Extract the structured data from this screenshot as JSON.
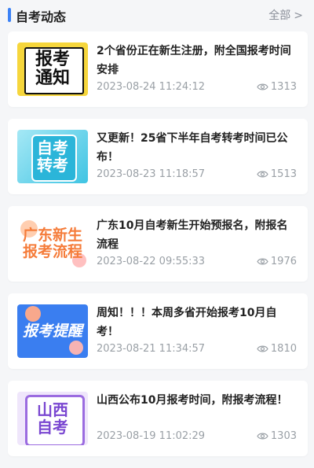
{
  "header": {
    "title": "自考动态",
    "more_label": "全部"
  },
  "news": [
    {
      "thumb": [
        "报考",
        "通知"
      ],
      "title": "2个省份正在新生注册，附全国报考时间安排",
      "date": "2023-08-24 11:24:12",
      "views": "1313"
    },
    {
      "thumb": [
        "自考",
        "转考"
      ],
      "title": "又更新！25省下半年自考转考时间已公布！",
      "date": "2023-08-23 11:18:57",
      "views": "1513"
    },
    {
      "thumb": [
        "广东新生",
        "报考流程"
      ],
      "title": "广东10月自考新生开始预报名，附报名流程",
      "date": "2023-08-22 09:55:33",
      "views": "1976"
    },
    {
      "thumb": [
        "报考提醒"
      ],
      "title": "周知！！！本周多省开始报考10月自考！",
      "date": "2023-08-21 11:34:57",
      "views": "1810"
    },
    {
      "thumb": [
        "山西",
        "自考"
      ],
      "title": "山西公布10月报考时间，附报考流程！",
      "date": "2023-08-19 11:02:29",
      "views": "1303"
    }
  ],
  "colors": {
    "accent": "#3b82f6",
    "meta_text": "#9aa0a6"
  }
}
